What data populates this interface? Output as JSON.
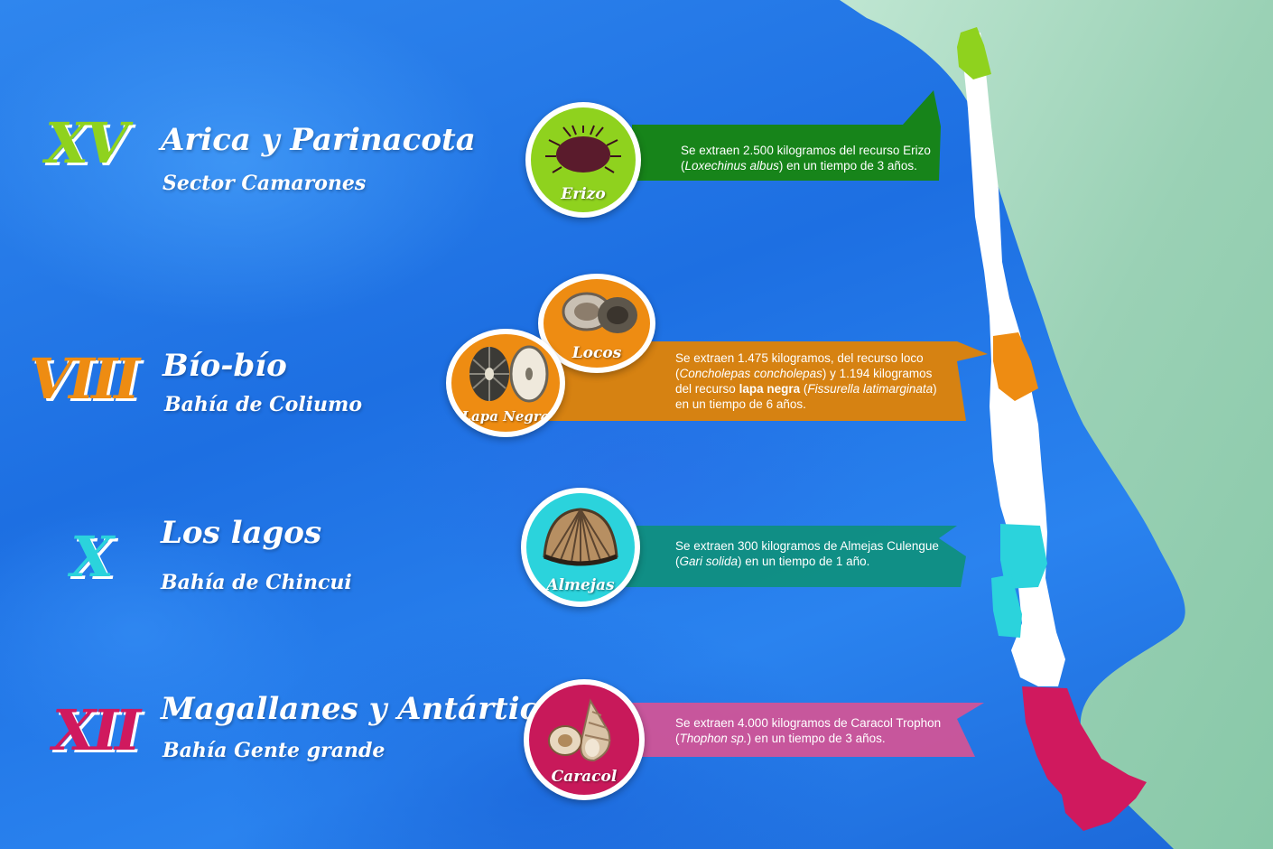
{
  "colors": {
    "green": "#8fd21e",
    "orange": "#ee8c12",
    "cyan": "#2bd3dc",
    "crimson": "#d0195e",
    "banner_green": "#17850f",
    "banner_orange": "#dc820a",
    "banner_teal": "#0f8f7f",
    "banner_pink": "#d45496",
    "ocean": "#2178e6",
    "land": "#9fd4b6"
  },
  "regions": [
    {
      "numeral": "XV",
      "name": "Arica y Parinacota",
      "sector": "Sector Camarones",
      "species": [
        {
          "label": "Erizo",
          "icon": "sea-urchin-icon"
        }
      ],
      "info": {
        "pre": "Se extraen 2.500 kilogramos del recurso Erizo",
        "sci_open": "(",
        "sci": "Loxechinus albus",
        "post": ") en un tiempo de 3 años."
      }
    },
    {
      "numeral": "VIII",
      "name": "Bío-bío",
      "sector": "Bahía de Coliumo",
      "species": [
        {
          "label": "Locos",
          "icon": "abalone-icon"
        },
        {
          "label": "Lapa Negra",
          "icon": "limpet-icon"
        }
      ],
      "info": {
        "line1": "Se extraen 1.475 kilogramos, del recurso loco",
        "sci1": "Concholepas concholepas",
        "mid": "y  1.194 kilogramos",
        "line3a": "del recurso",
        "bold": "lapa negra",
        "sci2": "Fissurella latimarginata",
        "line4": "en un tiempo de 6 años."
      }
    },
    {
      "numeral": "X",
      "name": "Los lagos",
      "sector": "Bahía de Chincui",
      "species": [
        {
          "label": "Almejas",
          "icon": "clam-icon"
        }
      ],
      "info": {
        "pre": "Se extraen 300 kilogramos de Almejas Culengue",
        "sci_open": "(",
        "sci": "Gari solida",
        "post": ") en un tiempo de 1 año."
      }
    },
    {
      "numeral": "XII",
      "name": "Magallanes y Antártica",
      "sector": "Bahía Gente grande",
      "species": [
        {
          "label": "Caracol",
          "icon": "snail-shell-icon"
        }
      ],
      "info": {
        "pre": "Se extraen 4.000 kilogramos de Caracol Trophon",
        "sci_open": "(",
        "sci": "Thophon sp.",
        "post": ") en un tiempo de 3 años."
      }
    }
  ]
}
